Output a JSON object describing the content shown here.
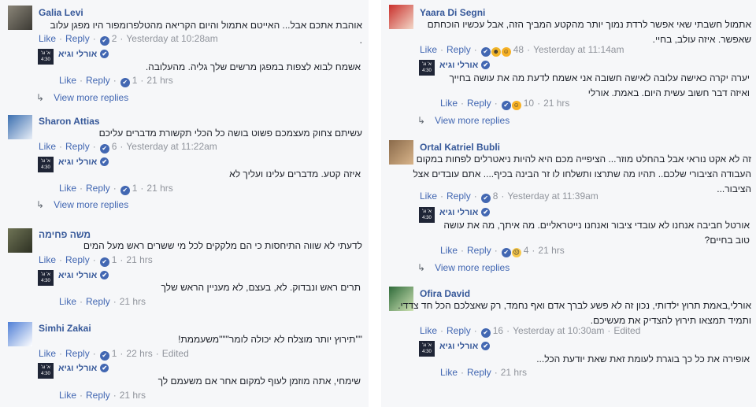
{
  "ui": {
    "like": "Like",
    "reply": "Reply",
    "view_more_replies": "View more replies",
    "verified_icon": "✔",
    "reply_arrow": "↳"
  },
  "author": {
    "name": "אורלי וגיא",
    "avatar_text": "א' וג' 4:30"
  },
  "left": [
    {
      "name": "Galia Levi",
      "avatar_colors": [
        "#8a8578",
        "#3c3a34"
      ],
      "text": "אוהבת אתכם אבל... האייטם אתמול והיום הקריאה מהטלפרומפור היו מפגן עלוב .",
      "reactions": [
        "like"
      ],
      "count": "2",
      "time": "Yesterday at 10:28am",
      "edited": "",
      "reply": {
        "text": "אשמח לבוא לצפות במפגן מרשים שלך גליה. מהעלובה.",
        "reactions": [
          "like"
        ],
        "count": "1",
        "time": "21 hrs"
      },
      "more": "View more replies"
    },
    {
      "name": "Sharon Attias",
      "avatar_colors": [
        "#3b6fb0",
        "#e8eef7"
      ],
      "text": "עשיתם צחוק מעצמכם פשוט בושה כל הכלי תקשורת מדברים עליכם",
      "reactions": [
        "like"
      ],
      "count": "6",
      "time": "Yesterday at 11:22am",
      "edited": "",
      "reply": {
        "text": "איזה קטע. מדברים עלינו ועליך לא",
        "reactions": [
          "like"
        ],
        "count": "1",
        "time": "21 hrs"
      },
      "more": "View more replies"
    },
    {
      "name": "משה פחימה",
      "avatar_colors": [
        "#6f7456",
        "#2d3022"
      ],
      "text": "לדעתי לא שווה התיחסות כי הם מלקקים לכל מי ששרים ראש מעל המים",
      "reactions": [
        "like"
      ],
      "count": "1",
      "time": "21 hrs",
      "edited": "",
      "reply": {
        "text": "תרים ראש ונבדוק. לא, בעצם, לא מעניין הראש שלך",
        "reactions": [],
        "count": "",
        "time": "21 hrs"
      },
      "more": ""
    },
    {
      "name": "Simhi Zakai",
      "avatar_colors": [
        "#4f7fd6",
        "#ffffff"
      ],
      "text": "\"\"תירוץ יותר מוצלח לא יכולה לומר\"\"\"משעממת!",
      "reactions": [
        "like"
      ],
      "count": "1",
      "time": "22 hrs",
      "edited": "Edited",
      "reply": {
        "text": "שימחי, אתה מוזמן לעוף למקום אחר אם משעמם לך",
        "reactions": [],
        "count": "",
        "time": "21 hrs"
      },
      "more": ""
    }
  ],
  "right": [
    {
      "name": "Yaara Di Segni",
      "avatar_colors": [
        "#c9302c",
        "#f3d7c8"
      ],
      "text": "אתמול חשבתי שאי אפשר לרדת נמוך יותר מהקטע המביך הזה, אבל עכשיו הוכחתם שאפשר. איזה עולב, בחיי.",
      "reactions": [
        "like",
        "wow",
        "haha"
      ],
      "count": "48",
      "time": "Yesterday at 11:14am",
      "edited": "",
      "reply": {
        "text": "יערה יקרה כאישה עלובה לאישה חשובה אני אשמח לדעת מה את עושה בחייך ואיזה דבר חשוב עשית היום. באמת. אורלי",
        "reactions": [
          "like",
          "haha"
        ],
        "count": "10",
        "time": "21 hrs"
      },
      "more": "View more replies"
    },
    {
      "name": "Ortal Katriel Bubli",
      "avatar_colors": [
        "#8a6a4a",
        "#d8b48a"
      ],
      "text": "זה לא אקט נוראי אבל בהחלט מוזר... הציפייה מכם היא להיות ניאטרלים לפחות במקום העבודה הציבורי שלכם.. תהיו מה שתרצו ותשלחו לו זר הבינה בכיף.... אתם עובדים אצל הציבור...",
      "reactions": [
        "like"
      ],
      "count": "8",
      "time": "Yesterday at 11:39am",
      "edited": "",
      "reply": {
        "text": "אורטל חביבה אנחנו לא עובדי ציבור ואנחנו נייטראליים. מה איתך, מה את עושה טוב בחיים?",
        "reactions": [
          "like",
          "sad"
        ],
        "count": "4",
        "time": "21 hrs"
      },
      "more": "View more replies"
    },
    {
      "name": "Ofira David",
      "avatar_colors": [
        "#2f6b3a",
        "#cfe3b5"
      ],
      "text": "אורלי,באמת תרוץ ילדותי, נכון זה לא פשע לברך אדם ואף נחמד, רק שאצלכם הכל חד צדדי. ותמיד תמצאו תירוץ להצדיק את מעשיכם.",
      "reactions": [
        "like"
      ],
      "count": "16",
      "time": "Yesterday at 10:30am",
      "edited": "Edited",
      "reply": {
        "text": "אופירה את כל כך בוגרת לעומת זאת שאת יודעת הכל...",
        "reactions": [],
        "count": "",
        "time": "21 hrs"
      },
      "more": ""
    }
  ]
}
